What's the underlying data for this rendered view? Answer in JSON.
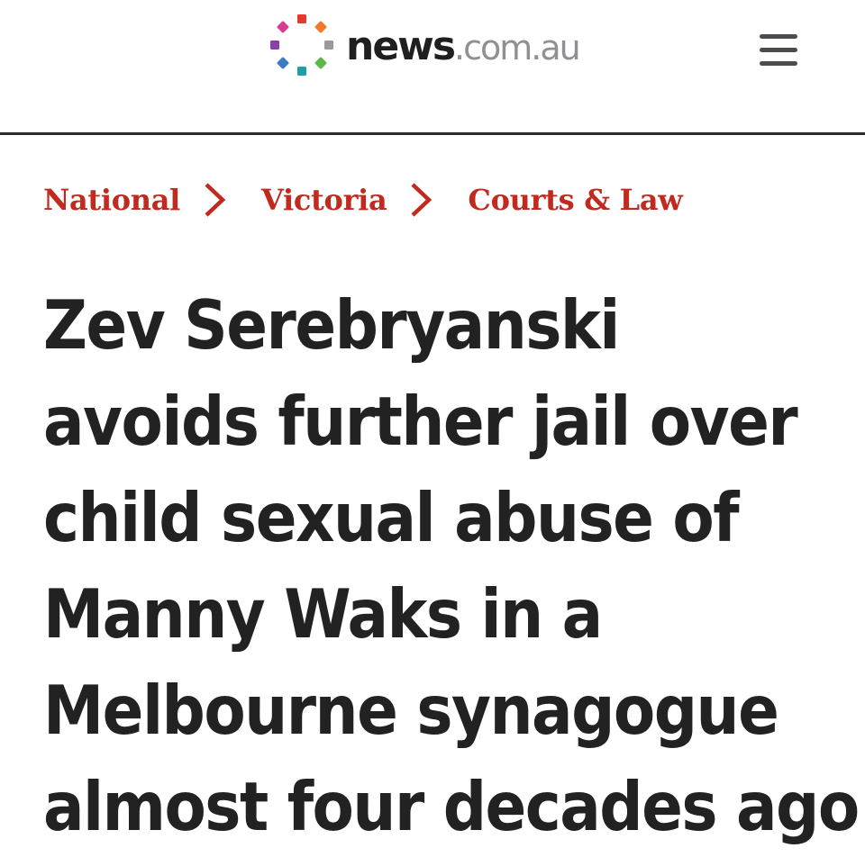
{
  "header": {
    "logo": {
      "name": "news",
      "domain": ".com.au",
      "dot_colors": [
        "#e23a2f",
        "#f07a2a",
        "#9a9a9a",
        "#5db848",
        "#1f9ea3",
        "#3b7cc4",
        "#8b3fa8",
        "#d63c8f"
      ]
    },
    "menu_icon": "hamburger-menu-icon"
  },
  "breadcrumb": {
    "items": [
      "National",
      "Victoria",
      "Courts & Law"
    ],
    "separator_icon": "chevron-right-icon",
    "color": "#c12a1e"
  },
  "article": {
    "headline_lines": [
      "Zev Serebryanski",
      "avoids further jail over",
      "child sexual abuse of",
      "Manny Waks in a",
      "Melbourne synagogue",
      "almost four decades ago"
    ]
  }
}
